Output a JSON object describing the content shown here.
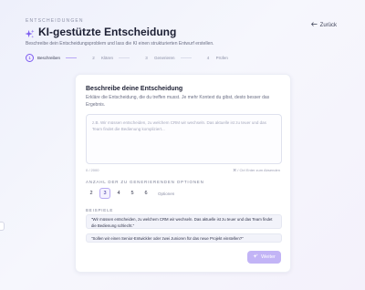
{
  "header": {
    "eyebrow": "ENTSCHEIDUNGEN",
    "title": "KI-gestützte Entscheidung",
    "subtitle": "Beschreibe dein Entscheidungsproblem und lass die KI einen strukturierten Entwurf erstellen.",
    "back_label": "Zurück",
    "accent": "#7c5cf0"
  },
  "stepper": [
    {
      "num": "1",
      "label": "Beschreiben",
      "active": true
    },
    {
      "num": "2",
      "label": "Klären",
      "active": false
    },
    {
      "num": "3",
      "label": "Generieren",
      "active": false
    },
    {
      "num": "4",
      "label": "Prüfen",
      "active": false
    }
  ],
  "card": {
    "title": "Beschreibe deine Entscheidung",
    "description": "Erkläre die Entscheidung, die du treffen musst. Je mehr Kontext du gibst, desto besser das Ergebnis.",
    "textarea": {
      "value": "",
      "placeholder": "z.B. Wir müssen entscheiden, zu welchem CRM wir wechseln. Das aktuelle ist zu teuer und das Team findet die Bedienung kompliziert..."
    },
    "char_count": "0 / 2000",
    "hint": "⌘ / Ctrl Enter zum Absenden",
    "options_label": "ANZAHL DER ZU GENERIERENDEN OPTIONEN",
    "options": [
      "2",
      "3",
      "4",
      "5",
      "6"
    ],
    "options_selected": "3",
    "options_suffix": "Optionen",
    "examples_label": "BEISPIELE",
    "examples": [
      "\"Wir müssen entscheiden, zu welchem CRM wir wechseln. Das aktuelle ist zu teuer und das Team findet die Bedienung schlecht.\"",
      "\"Sollen wir einen Senior-Entwickler oder zwei Junioren für das neue Projekt einstellen?\""
    ],
    "next_label": "Weiter",
    "next_color": "#c2b4f6"
  }
}
